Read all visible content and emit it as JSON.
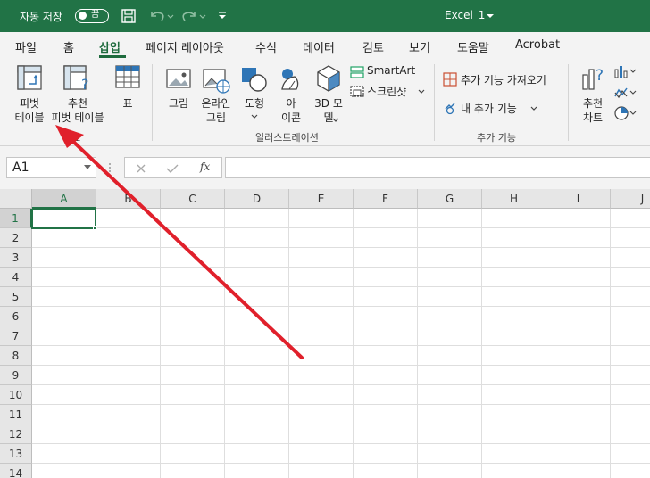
{
  "titlebar": {
    "autosave_label": "자동 저장",
    "autosave_state": "끔",
    "file_name": "Excel_1",
    "colors": {
      "bg": "#217346"
    }
  },
  "tabs": [
    "파일",
    "홈",
    "삽입",
    "페이지 레이아웃",
    "수식",
    "데이터",
    "검토",
    "보기",
    "도움말",
    "Acrobat"
  ],
  "active_tab": "삽입",
  "ribbon": {
    "pivot_table": {
      "line1": "피벗",
      "line2": "테이블"
    },
    "recommended_pivot": {
      "line1": "추천",
      "line2": "피벗 테이블"
    },
    "table": {
      "label": "표"
    },
    "group_tables": "표",
    "picture": {
      "label": "그림"
    },
    "online_picture": {
      "line1": "온라인",
      "line2": "그림"
    },
    "shapes": {
      "label": "도형"
    },
    "icons": {
      "line1": "아",
      "line2": "이콘"
    },
    "models3d": {
      "line1": "3D 모",
      "line2": "델"
    },
    "smartart": "SmartArt",
    "screenshot": "스크린샷",
    "group_illustrations": "일러스트레이션",
    "get_addins": "추가 기능 가져오기",
    "my_addins": "내 추가 기능",
    "group_addins": "추가 기능",
    "recommended_charts": {
      "line1": "추천",
      "line2": "차트"
    }
  },
  "formula_bar": {
    "name_box": "A1",
    "fx": "fx",
    "formula": ""
  },
  "columns": [
    "A",
    "B",
    "C",
    "D",
    "E",
    "F",
    "G",
    "H",
    "I",
    "J"
  ],
  "rows": [
    "1",
    "2",
    "3",
    "4",
    "5",
    "6",
    "7",
    "8",
    "9",
    "10",
    "11",
    "12",
    "13",
    "14"
  ],
  "annotation_color": "#e0202b"
}
